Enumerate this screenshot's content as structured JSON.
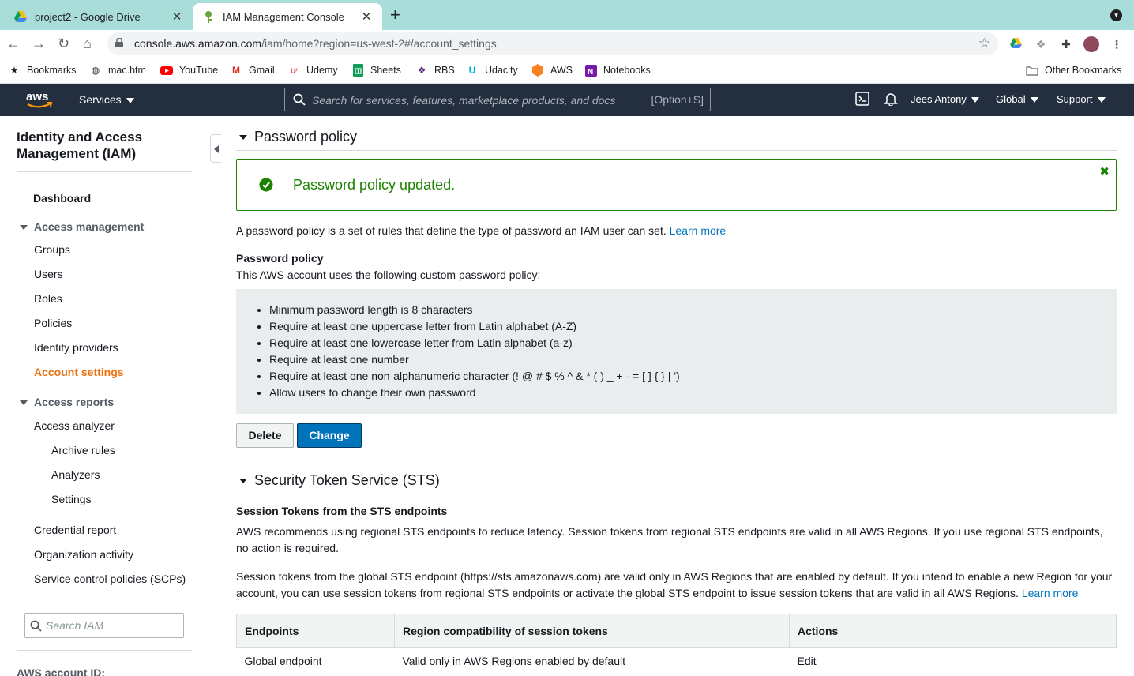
{
  "browser": {
    "tabs": [
      {
        "title": "project2 - Google Drive",
        "icon": "google-drive-icon"
      },
      {
        "title": "IAM Management Console",
        "icon": "aws-iam-icon"
      }
    ],
    "url_host": "console.aws.amazon.com",
    "url_path": "/iam/home?region=us-west-2#/account_settings",
    "bookmarks": [
      "Bookmarks",
      "mac.htm",
      "YouTube",
      "Gmail",
      "Udemy",
      "Sheets",
      "RBS",
      "Udacity",
      "AWS",
      "Notebooks"
    ],
    "other_bookmarks": "Other Bookmarks"
  },
  "aws_nav": {
    "logo": "aws",
    "services": "Services",
    "search_placeholder": "Search for services, features, marketplace products, and docs",
    "search_shortcut": "[Option+S]",
    "user": "Jees Antony",
    "region": "Global",
    "support": "Support"
  },
  "sidebar": {
    "title": "Identity and Access Management (IAM)",
    "dashboard": "Dashboard",
    "access_management": "Access management",
    "groups": "Groups",
    "users": "Users",
    "roles": "Roles",
    "policies": "Policies",
    "identity_providers": "Identity providers",
    "account_settings": "Account settings",
    "access_reports": "Access reports",
    "access_analyzer": "Access analyzer",
    "archive_rules": "Archive rules",
    "analyzers": "Analyzers",
    "settings": "Settings",
    "credential_report": "Credential report",
    "organization_activity": "Organization activity",
    "scps": "Service control policies (SCPs)",
    "search_placeholder": "Search IAM",
    "account_id_label": "AWS account ID:"
  },
  "password_policy": {
    "heading": "Password policy",
    "flash": "Password policy updated.",
    "intro": "A password policy is a set of rules that define the type of password an IAM user can set.",
    "learn_more": "Learn more",
    "subheading": "Password policy",
    "subtext": "This AWS account uses the following custom password policy:",
    "rules": [
      "Minimum password length is 8 characters",
      "Require at least one uppercase letter from Latin alphabet (A-Z)",
      "Require at least one lowercase letter from Latin alphabet (a-z)",
      "Require at least one number",
      "Require at least one non-alphanumeric character (! @ # $ % ^ & * ( ) _ + - = [ ] { } | ')",
      "Allow users to change their own password"
    ],
    "delete_label": "Delete",
    "change_label": "Change"
  },
  "sts": {
    "heading": "Security Token Service (STS)",
    "subheading": "Session Tokens from the STS endpoints",
    "para1": "AWS recommends using regional STS endpoints to reduce latency. Session tokens from regional STS endpoints are valid in all AWS Regions. If you use regional STS endpoints, no action is required.",
    "para2": "Session tokens from the global STS endpoint (https://sts.amazonaws.com) are valid only in AWS Regions that are enabled by default. If you intend to enable a new Region for your account, you can use session tokens from regional STS endpoints or activate the global STS endpoint to issue session tokens that are valid in all AWS Regions.",
    "learn_more": "Learn more",
    "table": {
      "headers": [
        "Endpoints",
        "Region compatibility of session tokens",
        "Actions"
      ],
      "rows": [
        [
          "Global endpoint",
          "Valid only in AWS Regions enabled by default",
          "Edit"
        ]
      ]
    }
  }
}
